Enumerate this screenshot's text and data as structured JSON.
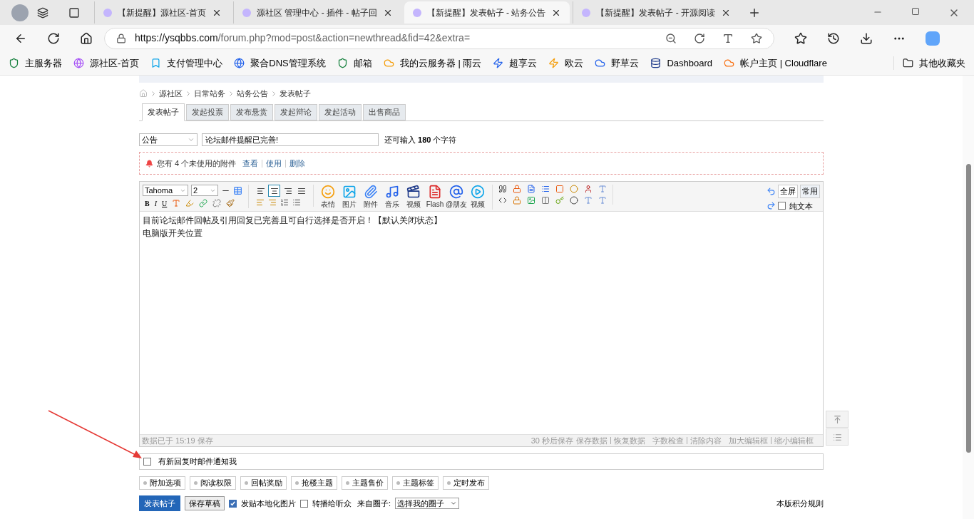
{
  "browser": {
    "tabs": [
      {
        "title": "【新提醒】源社区-首页",
        "selected": false
      },
      {
        "title": "源社区 管理中心 - 插件 - 帖子回",
        "selected": false
      },
      {
        "title": "【新提醒】发表帖子 - 站务公告",
        "selected": true
      },
      {
        "title": "【新提醒】发表帖子 - 开源阅读",
        "selected": false
      }
    ],
    "url_host": "https://ysqbbs.com",
    "url_path": "/forum.php?mod=post&action=newthread&fid=42&extra=",
    "bookmarks": [
      "主服务器",
      "源社区-首页",
      "支付管理中心",
      "聚合DNS管理系统",
      "邮箱",
      "我的云服务器 | 雨云",
      "超享云",
      "欧云",
      "野草云",
      "Dashboard",
      "帐户主页 | Cloudflare"
    ],
    "other_bookmarks": "其他收藏夹"
  },
  "breadcrumb": [
    "源社区",
    "日常站务",
    "站务公告",
    "发表帖子"
  ],
  "post_tabs": [
    {
      "label": "发表帖子",
      "selected": true
    },
    {
      "label": "发起投票",
      "selected": false
    },
    {
      "label": "发布悬赏",
      "selected": false
    },
    {
      "label": "发起辩论",
      "selected": false
    },
    {
      "label": "发起活动",
      "selected": false
    },
    {
      "label": "出售商品",
      "selected": false
    }
  ],
  "subject": {
    "type": "公告",
    "value": "论坛邮件提醒已完善!",
    "remaining": "还可输入 **180** 个字符"
  },
  "attachment_notice": {
    "text": "您有 4 个未使用的附件",
    "links": [
      "查看",
      "使用",
      "删除"
    ]
  },
  "editor": {
    "font": "Tahoma",
    "size": "2",
    "format_letters": [
      "B",
      "I",
      "U"
    ],
    "align_buttons": [
      {
        "selected": false
      },
      {
        "selected": true
      },
      {
        "selected": false
      },
      {
        "selected": false
      }
    ],
    "media_buttons": [
      "表情",
      "图片",
      "附件",
      "音乐",
      "视频",
      "Flash",
      "@朋友",
      "视频"
    ],
    "fullscreen": "全屏",
    "common": "常用",
    "plain_text": {
      "label": "纯文本",
      "checked": false
    },
    "content": [
      "目前论坛邮件回帖及引用回复已完善且可自行选择是否开启！【默认关闭状态】",
      "电脑版开关位置"
    ],
    "saved_note": "数据已于 15:19 保存",
    "status_groups": [
      {
        "prefix": "30 秒后保存",
        "links": [
          "保存数据",
          "恢复数据"
        ]
      },
      {
        "links": [
          "字数检查",
          "清除内容"
        ]
      },
      {
        "links": [
          "加大编辑框",
          "缩小编辑框"
        ]
      }
    ]
  },
  "email_notify": {
    "label": "有新回复时邮件通知我",
    "checked": false
  },
  "option_buttons": [
    "附加选项",
    "阅读权限",
    "回帖奖励",
    "抢楼主题",
    "主题售价",
    "主题标签",
    "定时发布"
  ],
  "actions": {
    "submit": "发表帖子",
    "draft": "保存草稿",
    "checks": [
      {
        "label": "发贴本地化图片",
        "checked": true
      },
      {
        "label": "转播给听众",
        "checked": false
      }
    ],
    "circle_label": "来自圈子:",
    "circle_value": "选择我的圈子",
    "rules": "本版积分规则"
  }
}
